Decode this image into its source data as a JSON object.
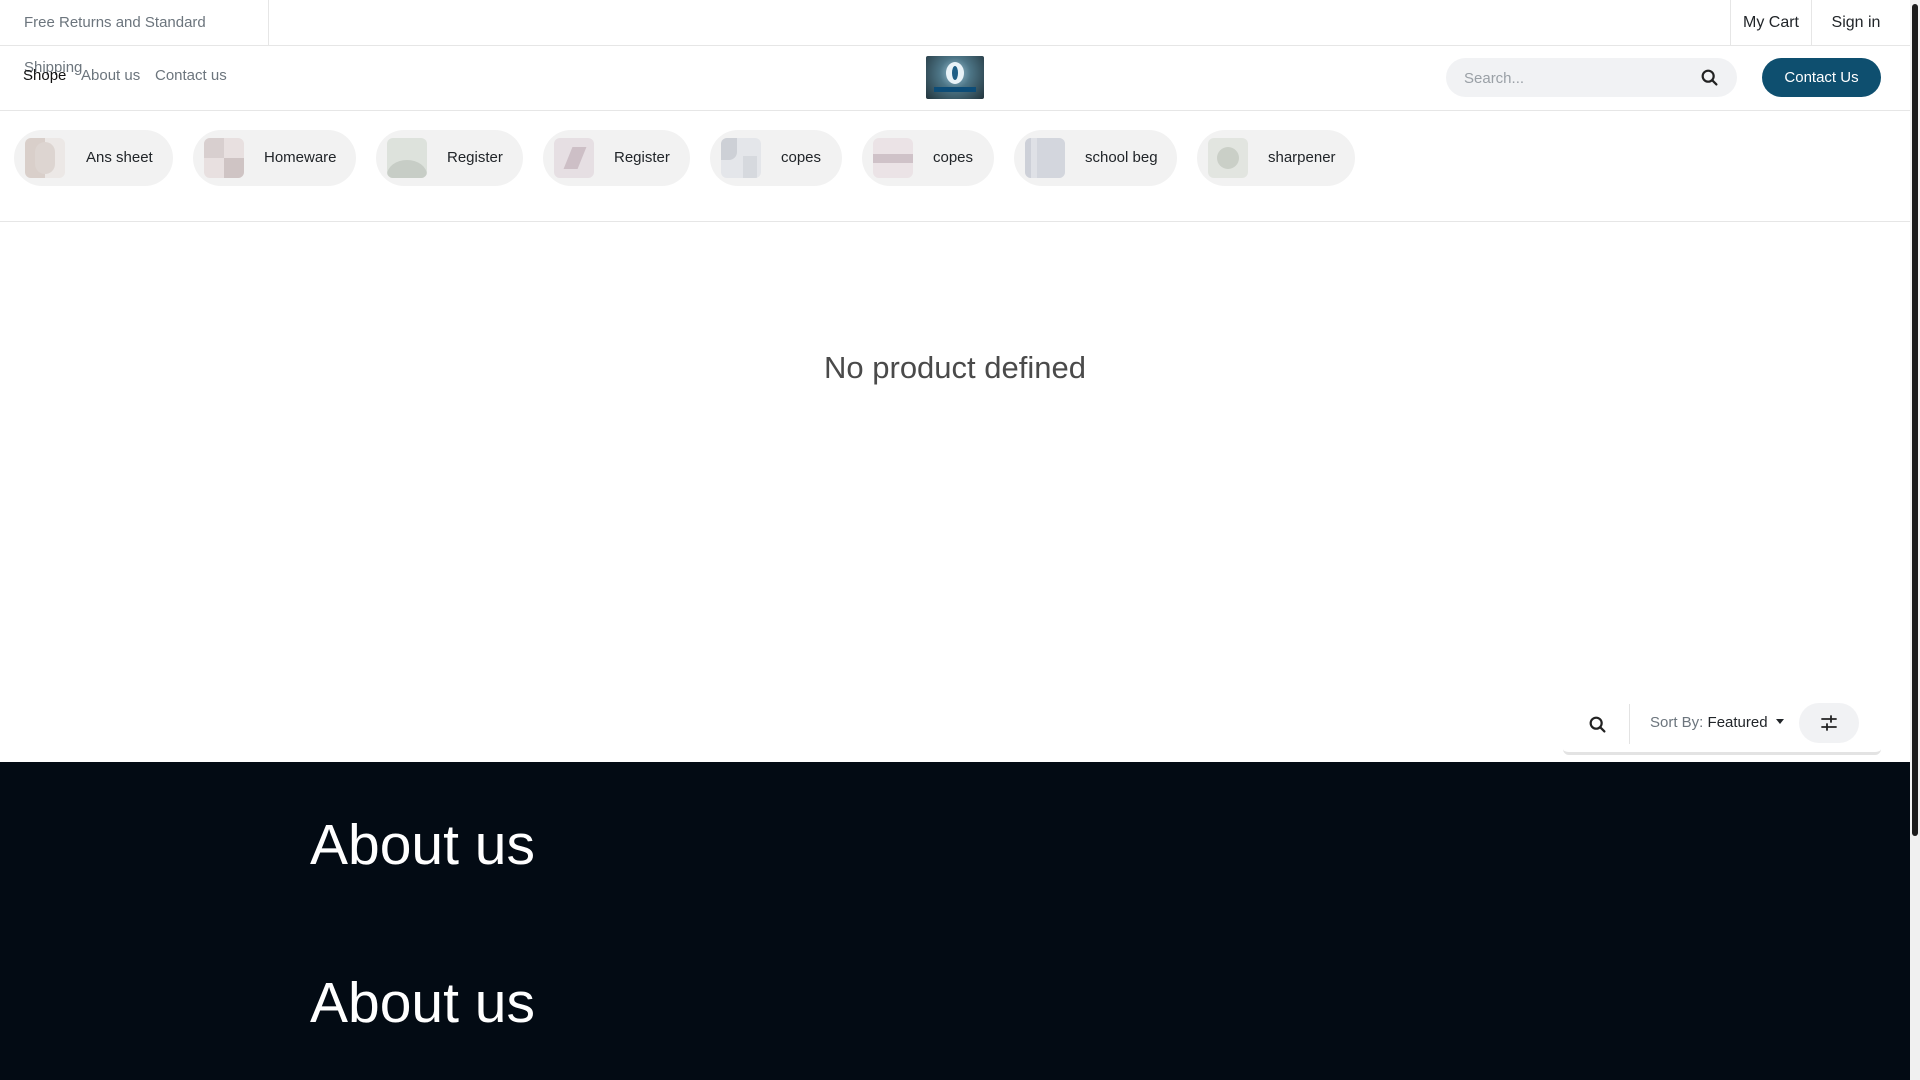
{
  "topbar": {
    "promo_text": "Free Returns and Standard Shipping",
    "cart_label": "My Cart",
    "signin_label": "Sign in"
  },
  "nav": {
    "links": [
      "Shope",
      "About us",
      "Contact us"
    ],
    "search_placeholder": "Search...",
    "contact_button": "Contact Us"
  },
  "categories": [
    {
      "label": "Ans sheet"
    },
    {
      "label": "Homeware"
    },
    {
      "label": "Register"
    },
    {
      "label": "Register"
    },
    {
      "label": "copes"
    },
    {
      "label": "copes"
    },
    {
      "label": "school beg"
    },
    {
      "label": "sharpener"
    }
  ],
  "main": {
    "empty_message": "No product defined"
  },
  "toolbar": {
    "sort_prefix": "Sort By:",
    "sort_value": "Featured"
  },
  "footer": {
    "headings": [
      "About us",
      "About us"
    ]
  },
  "colors": {
    "primary": "#0e4f6f",
    "footer_bg": "#030b14",
    "pill_bg": "#f2f2f2"
  }
}
